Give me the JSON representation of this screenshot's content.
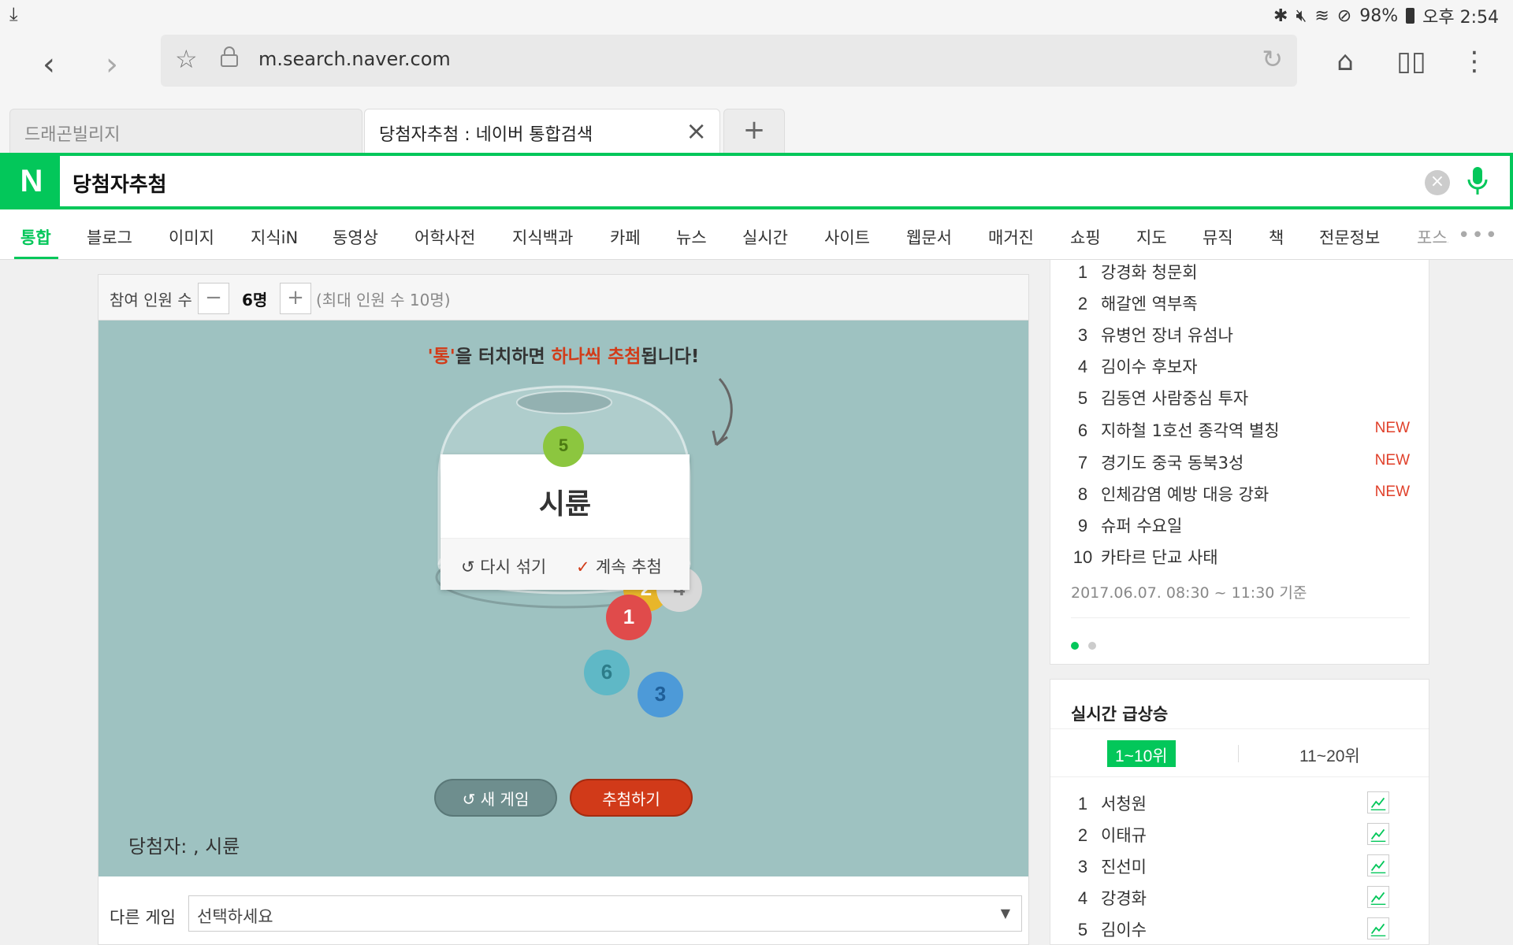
{
  "status_bar": {
    "battery": "98%",
    "time": "오후 2:54"
  },
  "browser": {
    "url": "m.search.naver.com",
    "tabs": [
      {
        "title": "드래곤빌리지",
        "active": false
      },
      {
        "title": "당첨자추첨 : 네이버 통합검색",
        "active": true
      }
    ],
    "new_tab_label": "+"
  },
  "search": {
    "logo": "N",
    "query": "당첨자추첨",
    "clear_label": "×"
  },
  "categories": [
    "통합",
    "블로그",
    "이미지",
    "지식iN",
    "동영상",
    "어학사전",
    "지식백과",
    "카페",
    "뉴스",
    "실시간",
    "사이트",
    "웹문서",
    "매거진",
    "쇼핑",
    "지도",
    "뮤직",
    "책",
    "전문정보",
    "포스트"
  ],
  "categories_more": "•••",
  "game": {
    "participants_label": "참여 인원 수",
    "minus": "−",
    "plus": "+",
    "count": "6명",
    "max_note": "(최대 인원 수 10명)",
    "hint_a": "'통'",
    "hint_b": "을 터치하면 ",
    "hint_c": "하나씩 추첨",
    "hint_d": "됩니다!",
    "drawn_ball": "5",
    "winner_name": "시륜",
    "reshuffle": "다시 섞기",
    "continue": "계속 추첨",
    "balls": [
      "2",
      "4",
      "1",
      "6",
      "3"
    ],
    "new_game": "새 게임",
    "draw": "추첨하기",
    "winners_text": "당첨자: , 시륜",
    "other_game_label": "다른 게임",
    "other_game_select": "선택하세요"
  },
  "realtime": {
    "items": [
      {
        "rank": "1",
        "text": "강경화 청문회",
        "badge": ""
      },
      {
        "rank": "2",
        "text": "해갈엔 역부족",
        "badge": ""
      },
      {
        "rank": "3",
        "text": "유병언 장녀 유섬나",
        "badge": ""
      },
      {
        "rank": "4",
        "text": "김이수 후보자",
        "badge": ""
      },
      {
        "rank": "5",
        "text": "김동연 사람중심 투자",
        "badge": ""
      },
      {
        "rank": "6",
        "text": "지하철 1호선 종각역 별칭",
        "badge": "NEW"
      },
      {
        "rank": "7",
        "text": "경기도 중국 동북3성",
        "badge": "NEW"
      },
      {
        "rank": "8",
        "text": "인체감염 예방 대응 강화",
        "badge": "NEW"
      },
      {
        "rank": "9",
        "text": "슈퍼 수요일",
        "badge": ""
      },
      {
        "rank": "10",
        "text": "카타르 단교 사태",
        "badge": ""
      }
    ],
    "basis": "2017.06.07. 08:30 ~ 11:30 기준"
  },
  "rising": {
    "title": "실시간 급상승",
    "tabs": [
      "1~10위",
      "11~20위"
    ],
    "items": [
      {
        "rank": "1",
        "text": "서청원"
      },
      {
        "rank": "2",
        "text": "이태규"
      },
      {
        "rank": "3",
        "text": "진선미"
      },
      {
        "rank": "4",
        "text": "강경화"
      },
      {
        "rank": "5",
        "text": "김이수"
      }
    ]
  },
  "colors": {
    "naver_green": "#03c75a",
    "accent_red": "#d23c19",
    "game_bg": "#9ec2c1"
  }
}
